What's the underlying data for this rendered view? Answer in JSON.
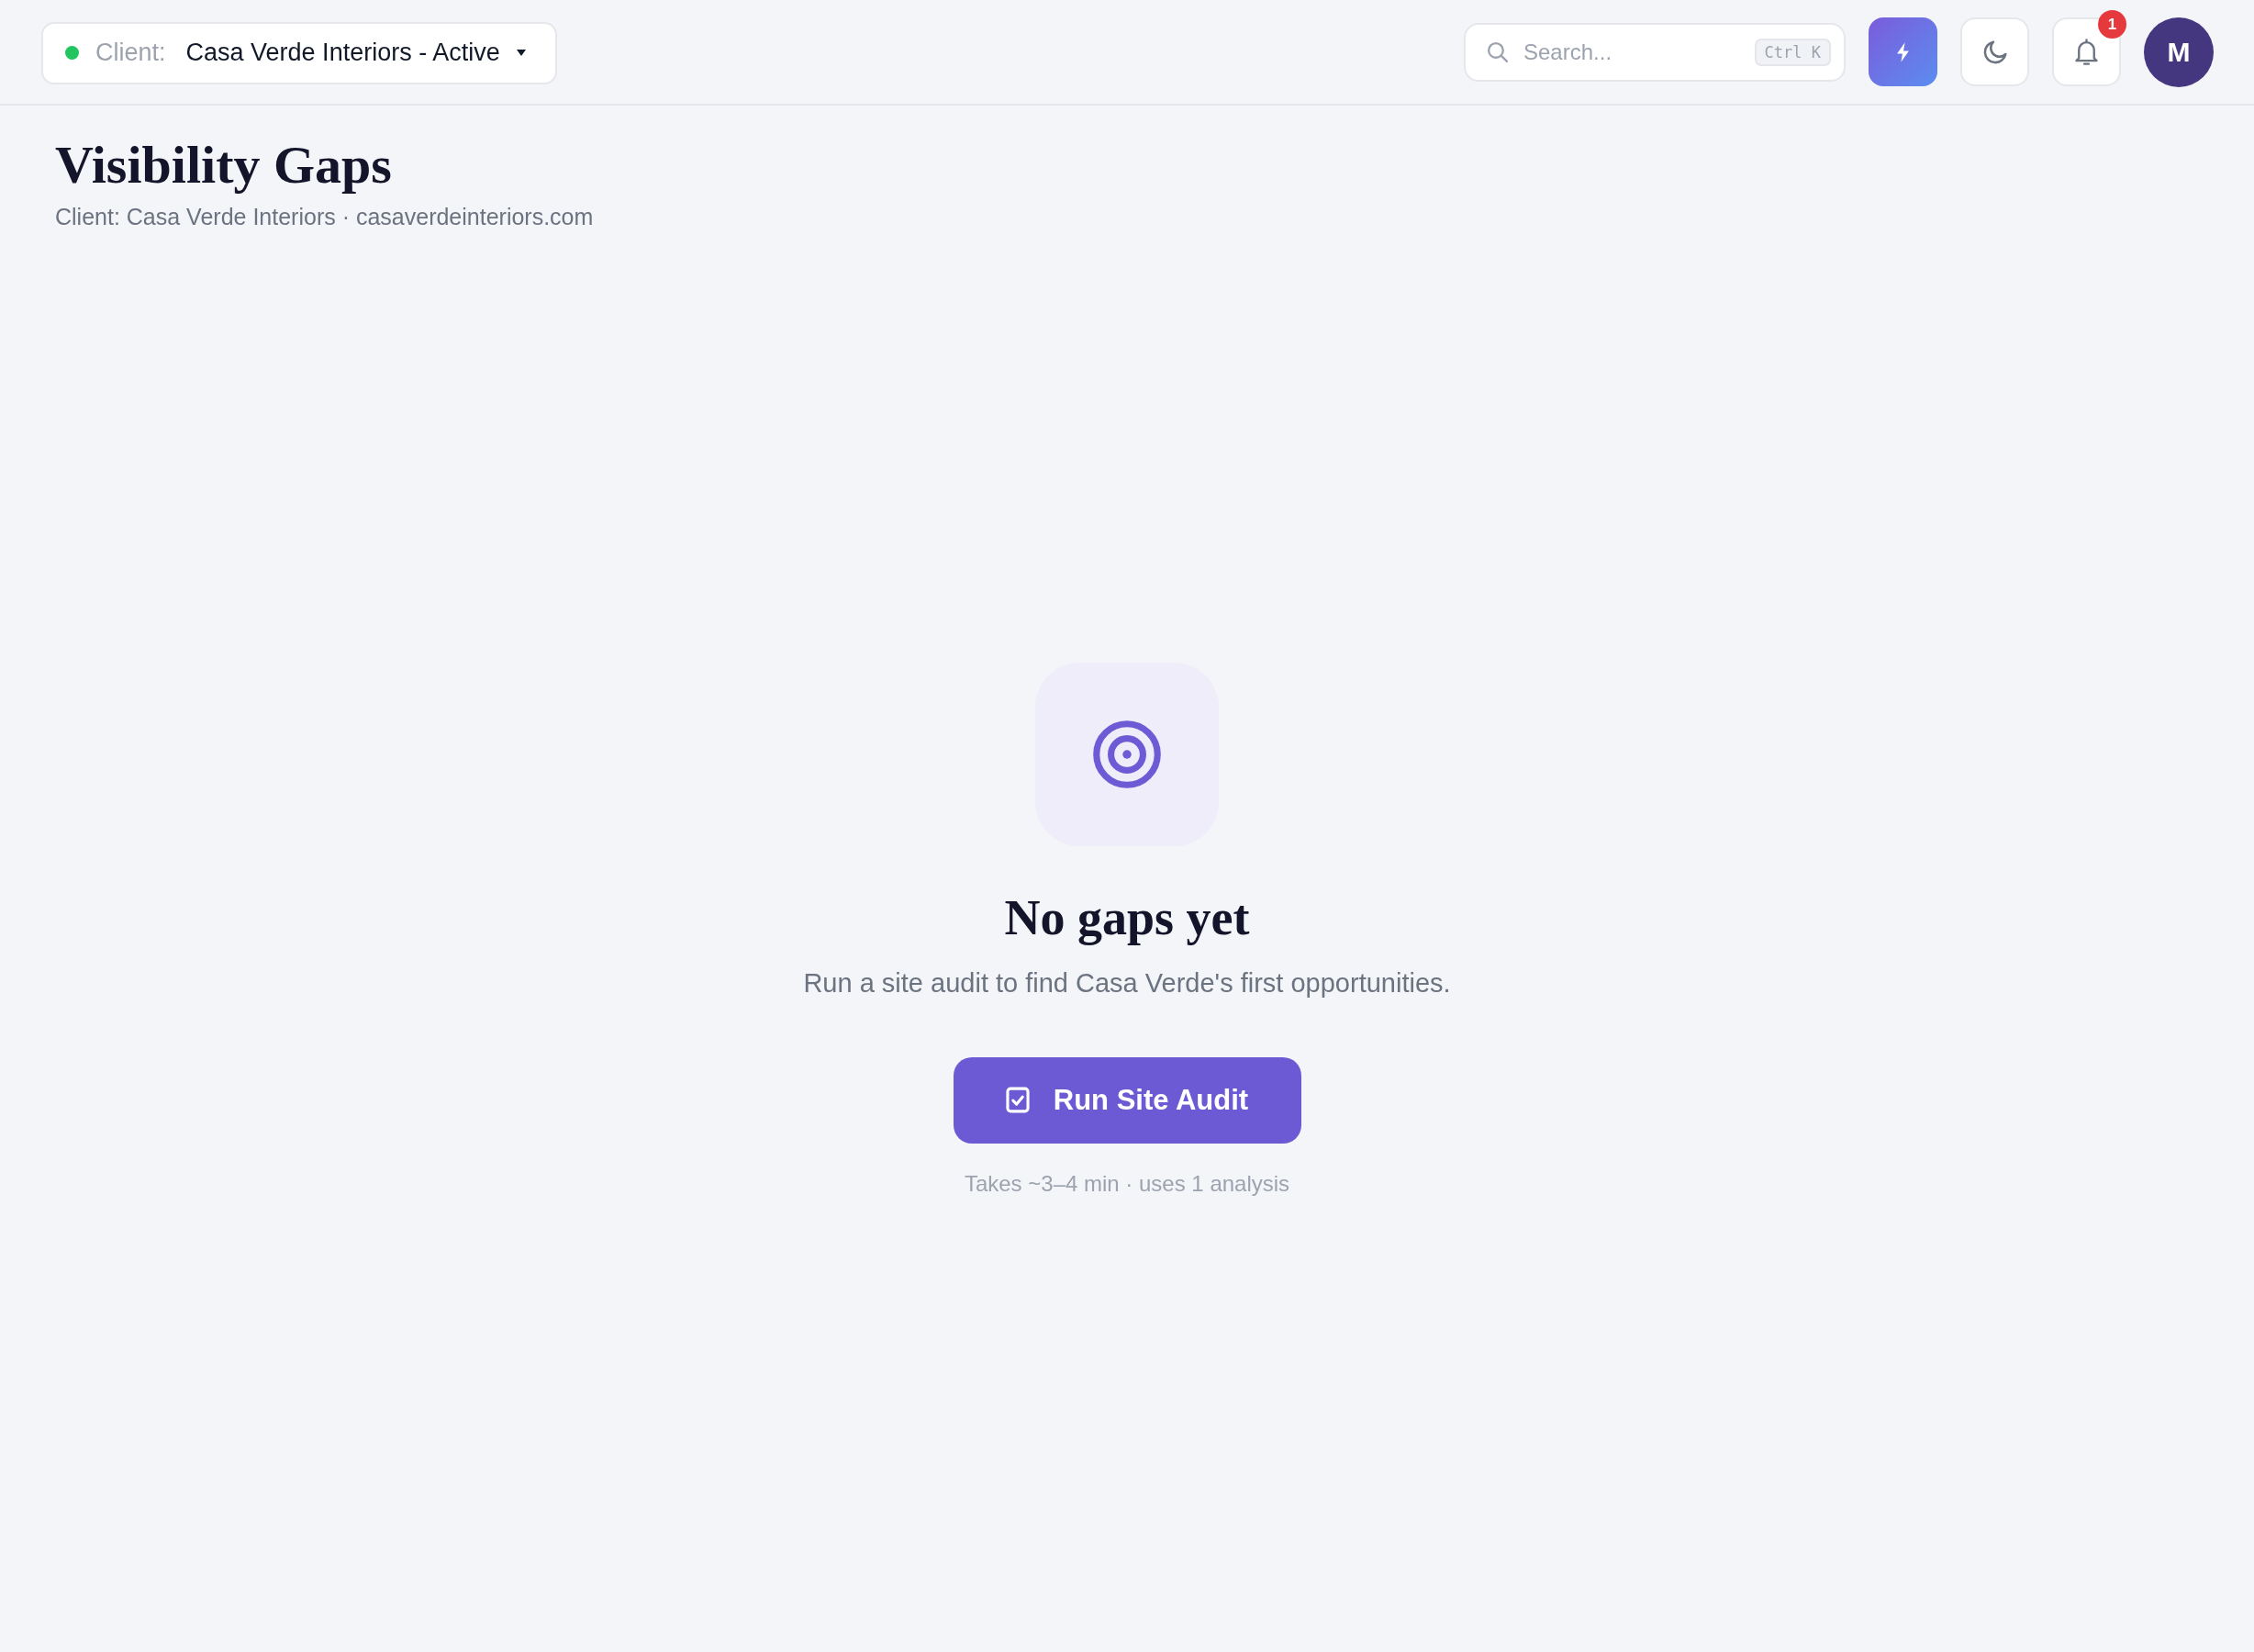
{
  "header": {
    "client_selector": {
      "active": true,
      "label": "Client:",
      "value": "Casa Verde Interiors - Active"
    },
    "search": {
      "placeholder": "Search...",
      "shortcut": "Ctrl K"
    },
    "notifications": {
      "badge": "1"
    },
    "avatar": {
      "initial": "M"
    }
  },
  "page": {
    "title": "Visibility Gaps",
    "subtitle": "Client: Casa Verde Interiors · casaverdeinteriors.com"
  },
  "empty_state": {
    "title": "No gaps yet",
    "description": "Run a site audit to find Casa Verde's first opportunities.",
    "button": "Run Site Audit",
    "note": "Takes ~3–4 min · uses 1 analysis"
  }
}
